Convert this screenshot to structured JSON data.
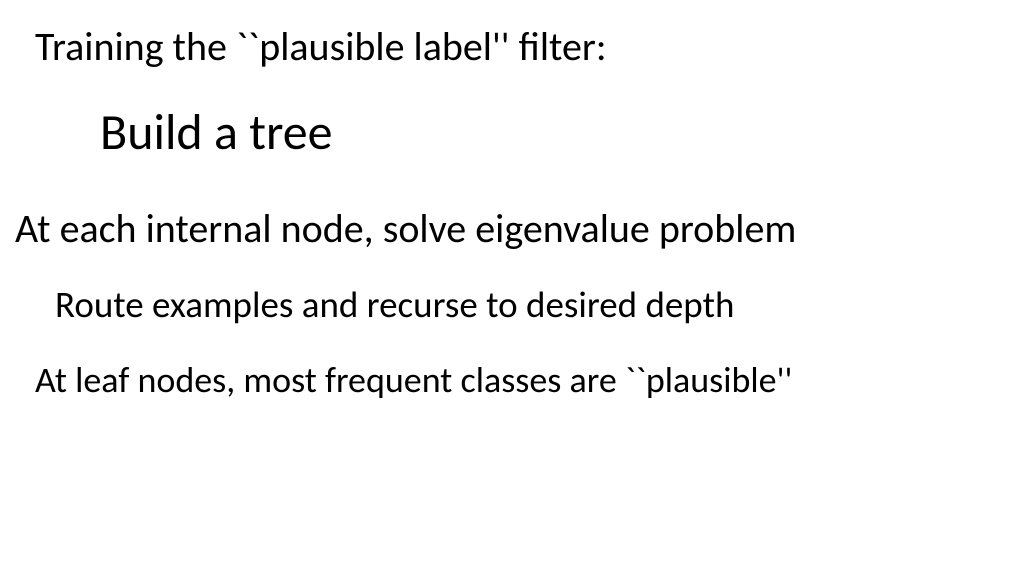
{
  "slide": {
    "line1": "Training the ``plausible label'' filter:",
    "line2": "Build a tree",
    "line3": "At each internal node, solve eigenvalue problem",
    "line4": "Route examples and recurse to desired depth",
    "line5": "At leaf nodes, most frequent classes are ``plausible''"
  }
}
